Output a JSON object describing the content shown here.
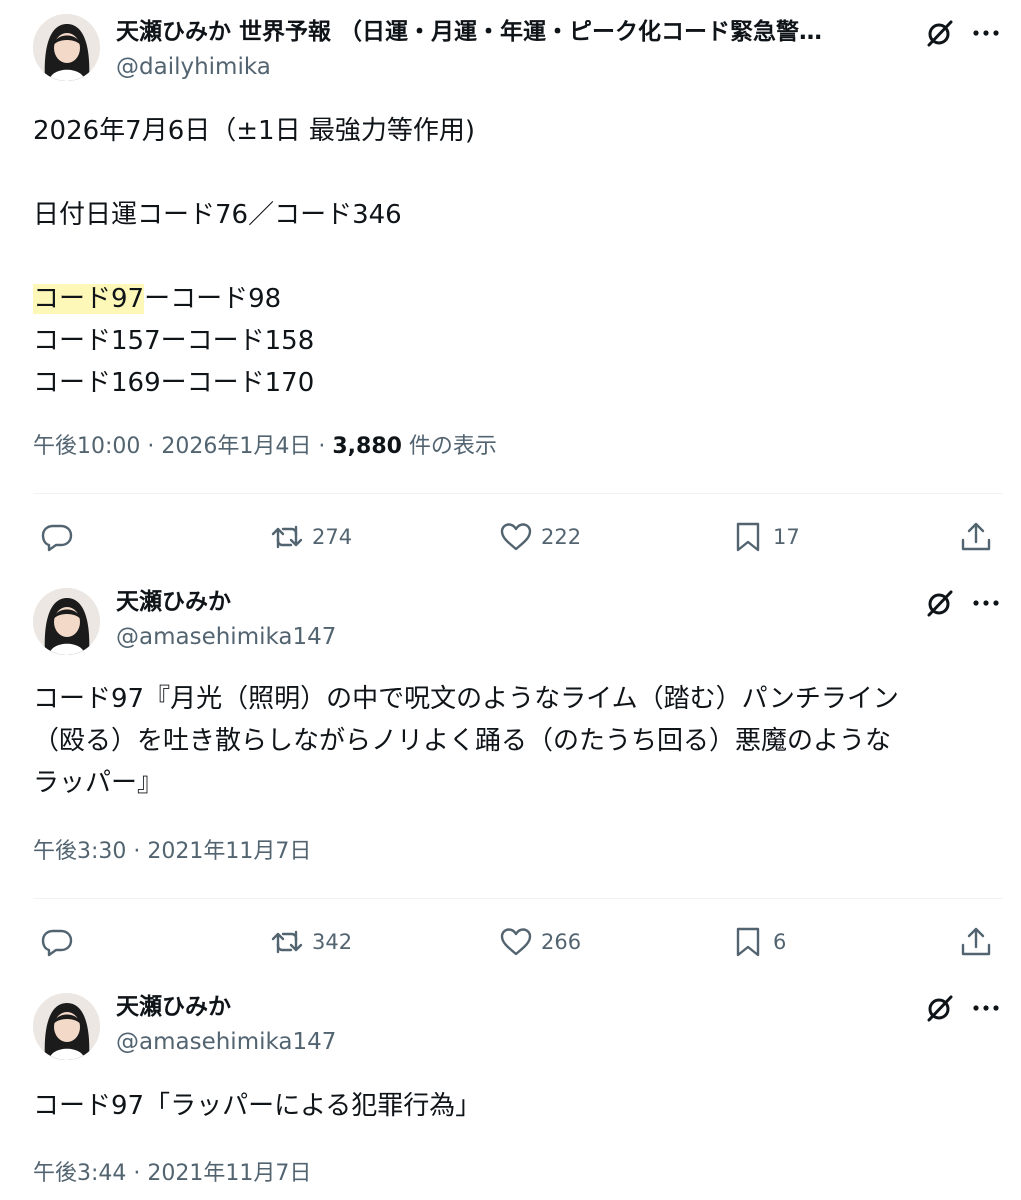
{
  "tweets": [
    {
      "name": "天瀬ひみか 世界予報 （日運・月運・年運・ピーク化コード緊急警…",
      "handle": "@dailyhimika",
      "lines": [
        "2026年7月6日（±1日 最強力等作用)",
        "",
        "日付日運コード76／コード346",
        ""
      ],
      "highlight_prefix": "コード97",
      "highlight_rest": "ーコード98",
      "extra_lines": [
        "コード157ーコード158",
        "コード169ーコード170"
      ],
      "time": "午後10:00 · 2026年1月4日 · ",
      "views_count": "3,880",
      "views_label": " 件の表示",
      "replies": "",
      "retweets": "274",
      "likes": "222",
      "bookmarks": "17"
    },
    {
      "name": "天瀬ひみか",
      "handle": "@amasehimika147",
      "lines": [
        "コード97『月光（照明）の中で呪文のようなライム（踏む）パンチライン",
        "（殴る）を吐き散らしながらノリよく踊る（のたうち回る）悪魔のような",
        "ラッパー』"
      ],
      "time": "午後3:30 · 2021年11月7日",
      "replies": "",
      "retweets": "342",
      "likes": "266",
      "bookmarks": "6"
    },
    {
      "name": "天瀬ひみか",
      "handle": "@amasehimika147",
      "lines": [
        "コード97「ラッパーによる犯罪行為」"
      ],
      "time": "午後3:44 · 2021年11月7日"
    }
  ],
  "icons": {
    "reply": "reply-icon",
    "retweet": "retweet-icon",
    "like": "heart-icon",
    "bookmark": "bookmark-icon",
    "share": "share-icon",
    "grok": "grok-icon",
    "more": "more-icon"
  },
  "colors": {
    "text": "#0f1419",
    "secondary": "#536471",
    "highlight": "#fdf7b8",
    "divider": "#eff3f4"
  }
}
